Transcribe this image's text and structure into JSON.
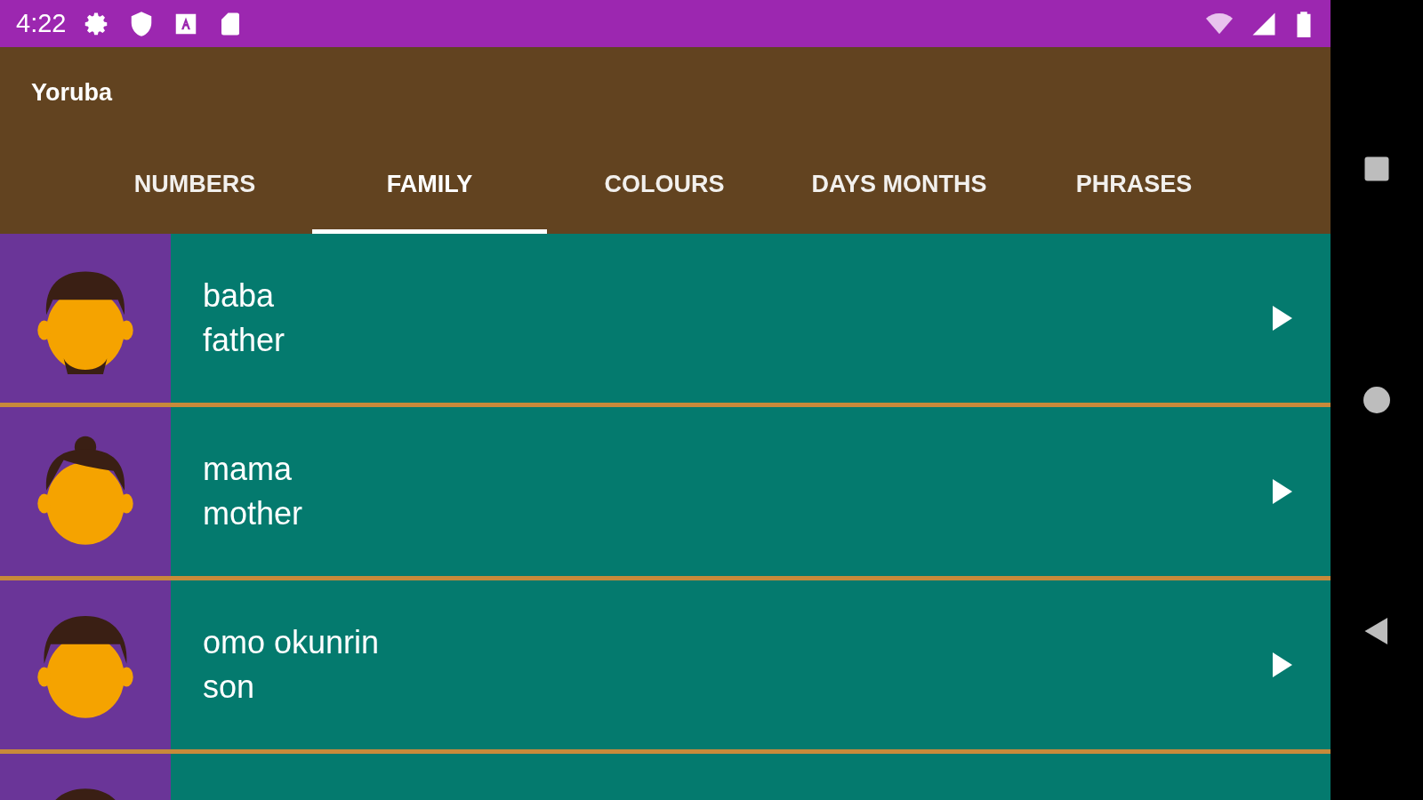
{
  "status_bar": {
    "time": "4:22"
  },
  "app_bar": {
    "title": "Yoruba"
  },
  "tabs": [
    {
      "label": "NUMBERS",
      "selected": false
    },
    {
      "label": "FAMILY",
      "selected": true
    },
    {
      "label": "COLOURS",
      "selected": false
    },
    {
      "label": "DAYS MONTHS",
      "selected": false
    },
    {
      "label": "PHRASES",
      "selected": false
    }
  ],
  "rows": [
    {
      "kind": "bearded",
      "word": "baba",
      "translation": "father"
    },
    {
      "kind": "woman",
      "word": "mama",
      "translation": "mother"
    },
    {
      "kind": "man",
      "word": "omo okunrin",
      "translation": "son"
    },
    {
      "kind": "man"
    }
  ]
}
